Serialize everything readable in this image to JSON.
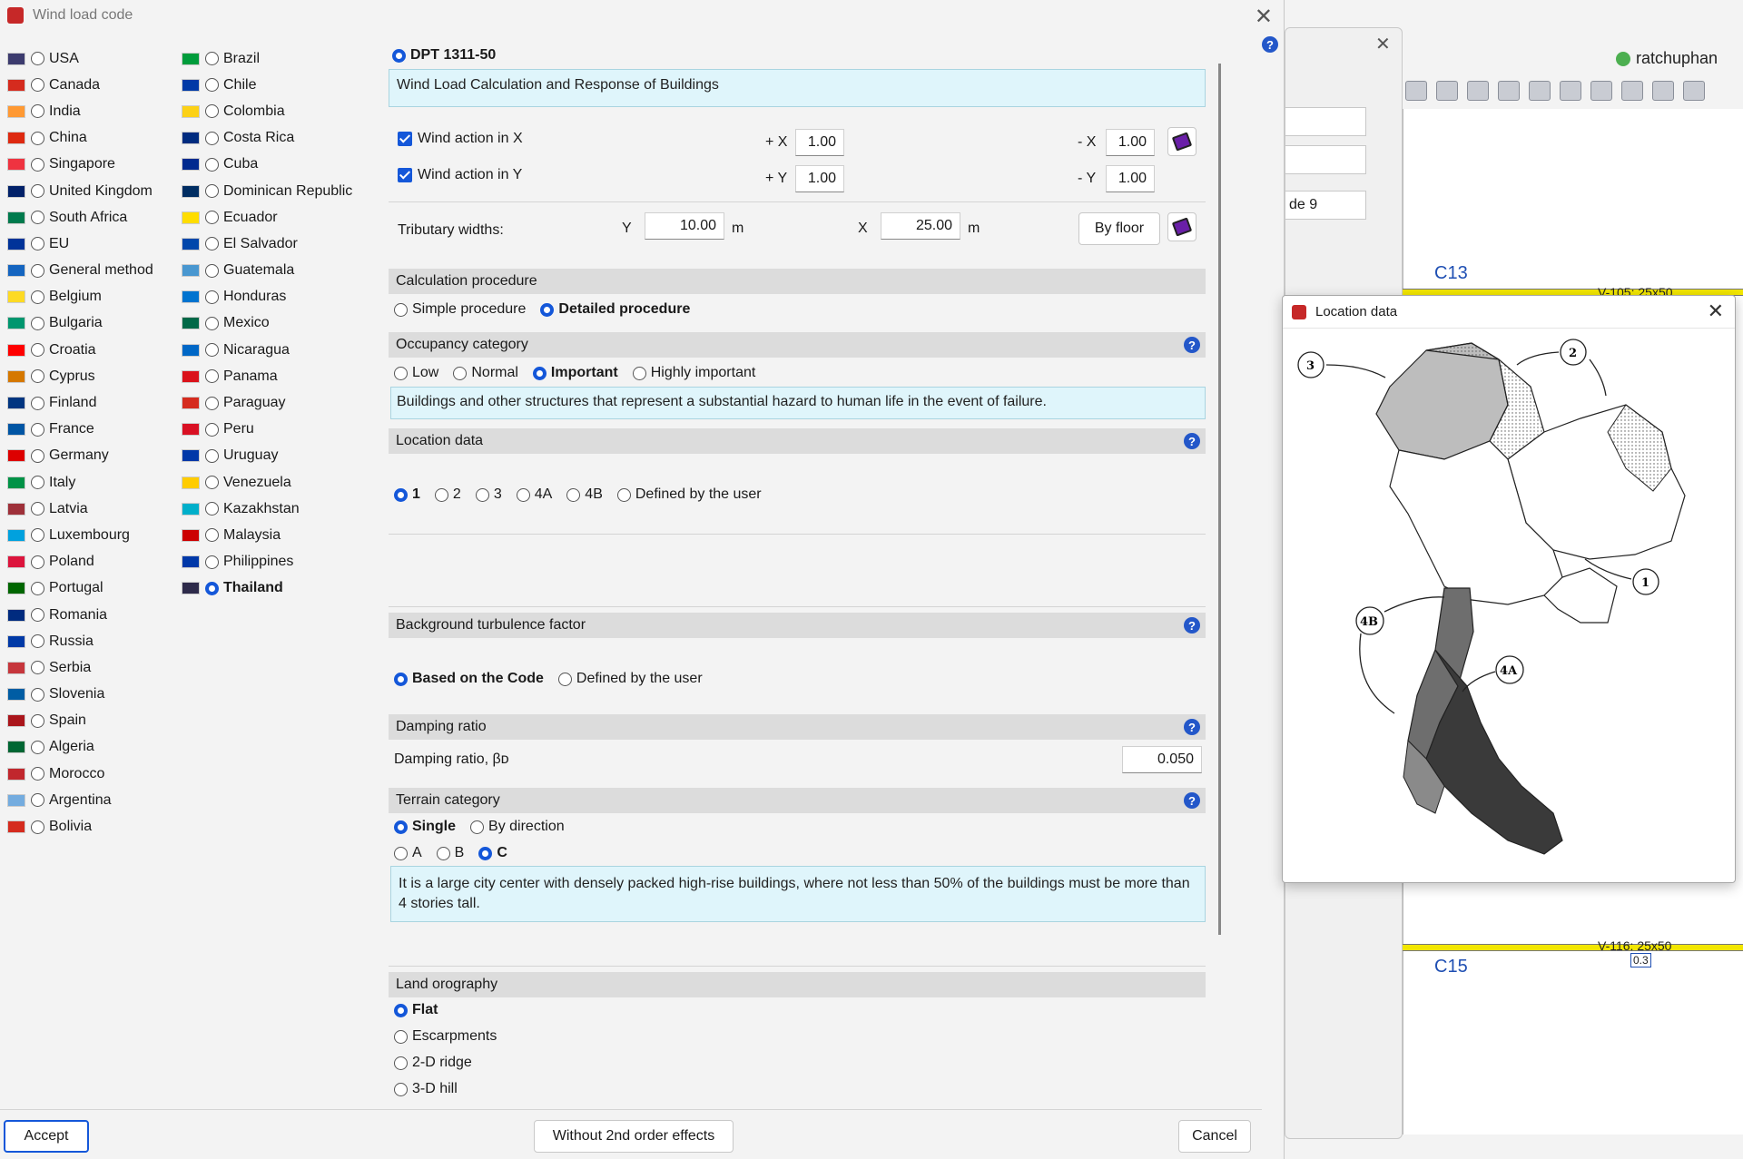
{
  "dialog": {
    "title": "Wind load code",
    "accept": "Accept",
    "second_order": "Without 2nd order effects",
    "cancel": "Cancel"
  },
  "countries_col1": [
    {
      "name": "USA",
      "selected": false,
      "flag_color": "#3c3b6e"
    },
    {
      "name": "Canada",
      "selected": false,
      "flag_color": "#d52b1e"
    },
    {
      "name": "India",
      "selected": false,
      "flag_color": "#ff9933"
    },
    {
      "name": "China",
      "selected": false,
      "flag_color": "#de2910"
    },
    {
      "name": "Singapore",
      "selected": false,
      "flag_color": "#ef3340"
    },
    {
      "name": "United Kingdom",
      "selected": false,
      "flag_color": "#012169"
    },
    {
      "name": "South Africa",
      "selected": false,
      "flag_color": "#007a4d"
    },
    {
      "name": "EU",
      "selected": false,
      "flag_color": "#003399"
    },
    {
      "name": "General method",
      "selected": false,
      "flag_color": "#1565c0"
    },
    {
      "name": "Belgium",
      "selected": false,
      "flag_color": "#fdda24"
    },
    {
      "name": "Bulgaria",
      "selected": false,
      "flag_color": "#00966e"
    },
    {
      "name": "Croatia",
      "selected": false,
      "flag_color": "#ff0000"
    },
    {
      "name": "Cyprus",
      "selected": false,
      "flag_color": "#d57800"
    },
    {
      "name": "Finland",
      "selected": false,
      "flag_color": "#003580"
    },
    {
      "name": "France",
      "selected": false,
      "flag_color": "#0055a4"
    },
    {
      "name": "Germany",
      "selected": false,
      "flag_color": "#dd0000"
    },
    {
      "name": "Italy",
      "selected": false,
      "flag_color": "#009246"
    },
    {
      "name": "Latvia",
      "selected": false,
      "flag_color": "#9e3039"
    },
    {
      "name": "Luxembourg",
      "selected": false,
      "flag_color": "#00a1de"
    },
    {
      "name": "Poland",
      "selected": false,
      "flag_color": "#dc143c"
    },
    {
      "name": "Portugal",
      "selected": false,
      "flag_color": "#006600"
    },
    {
      "name": "Romania",
      "selected": false,
      "flag_color": "#002b7f"
    },
    {
      "name": "Russia",
      "selected": false,
      "flag_color": "#0039a6"
    },
    {
      "name": "Serbia",
      "selected": false,
      "flag_color": "#c6363c"
    },
    {
      "name": "Slovenia",
      "selected": false,
      "flag_color": "#005da4"
    },
    {
      "name": "Spain",
      "selected": false,
      "flag_color": "#aa151b"
    },
    {
      "name": "Algeria",
      "selected": false,
      "flag_color": "#006633"
    },
    {
      "name": "Morocco",
      "selected": false,
      "flag_color": "#c1272d"
    },
    {
      "name": "Argentina",
      "selected": false,
      "flag_color": "#74acdf"
    },
    {
      "name": "Bolivia",
      "selected": false,
      "flag_color": "#d52b1e"
    }
  ],
  "countries_col2": [
    {
      "name": "Brazil",
      "selected": false,
      "flag_color": "#009c3b"
    },
    {
      "name": "Chile",
      "selected": false,
      "flag_color": "#0039a6"
    },
    {
      "name": "Colombia",
      "selected": false,
      "flag_color": "#fcd116"
    },
    {
      "name": "Costa Rica",
      "selected": false,
      "flag_color": "#002b7f"
    },
    {
      "name": "Cuba",
      "selected": false,
      "flag_color": "#002a8f"
    },
    {
      "name": "Dominican Republic",
      "selected": false,
      "flag_color": "#002d62"
    },
    {
      "name": "Ecuador",
      "selected": false,
      "flag_color": "#ffdd00"
    },
    {
      "name": "El Salvador",
      "selected": false,
      "flag_color": "#0047ab"
    },
    {
      "name": "Guatemala",
      "selected": false,
      "flag_color": "#4997d0"
    },
    {
      "name": "Honduras",
      "selected": false,
      "flag_color": "#0073cf"
    },
    {
      "name": "Mexico",
      "selected": false,
      "flag_color": "#006847"
    },
    {
      "name": "Nicaragua",
      "selected": false,
      "flag_color": "#0067c6"
    },
    {
      "name": "Panama",
      "selected": false,
      "flag_color": "#da121a"
    },
    {
      "name": "Paraguay",
      "selected": false,
      "flag_color": "#d52b1e"
    },
    {
      "name": "Peru",
      "selected": false,
      "flag_color": "#d91023"
    },
    {
      "name": "Uruguay",
      "selected": false,
      "flag_color": "#0038a8"
    },
    {
      "name": "Venezuela",
      "selected": false,
      "flag_color": "#ffcc00"
    },
    {
      "name": "Kazakhstan",
      "selected": false,
      "flag_color": "#00afca"
    },
    {
      "name": "Malaysia",
      "selected": false,
      "flag_color": "#cc0001"
    },
    {
      "name": "Philippines",
      "selected": false,
      "flag_color": "#0038a8"
    },
    {
      "name": "Thailand",
      "selected": true,
      "flag_color": "#2d2a4a"
    }
  ],
  "code": {
    "name": "DPT 1311-50",
    "description": "Wind Load Calculation and Response of Buildings"
  },
  "wind": {
    "x_label": "Wind action in X",
    "y_label": "Wind action in Y",
    "plus_x": "+ X",
    "plus_x_val": "1.00",
    "minus_x": "- X",
    "minus_x_val": "1.00",
    "plus_y": "+ Y",
    "plus_y_val": "1.00",
    "minus_y": "- Y",
    "minus_y_val": "1.00"
  },
  "tributary": {
    "label": "Tributary widths:",
    "y_label": "Y",
    "y_val": "10.00",
    "y_unit": "m",
    "x_label": "X",
    "x_val": "25.00",
    "x_unit": "m",
    "by_floor": "By floor"
  },
  "calc": {
    "head": "Calculation procedure",
    "simple": "Simple procedure",
    "detailed": "Detailed procedure"
  },
  "occupancy": {
    "head": "Occupancy category",
    "low": "Low",
    "normal": "Normal",
    "important": "Important",
    "highly": "Highly important",
    "desc": "Buildings and other structures that represent a substantial hazard to human life in the event of failure."
  },
  "location": {
    "head": "Location data",
    "z1": "1",
    "z2": "2",
    "z3": "3",
    "z4a": "4A",
    "z4b": "4B",
    "user": "Defined by the user"
  },
  "turbulence": {
    "head": "Background turbulence factor",
    "code": "Based on the Code",
    "user": "Defined by the user"
  },
  "damping": {
    "head": "Damping ratio",
    "label": "Damping ratio, βᴅ",
    "value": "0.050"
  },
  "terrain": {
    "head": "Terrain category",
    "single": "Single",
    "by_direction": "By direction",
    "a": "A",
    "b": "B",
    "c": "C",
    "desc": "It is a large city center with densely packed high-rise buildings, where not less than 50% of the buildings must be more than 4 stories tall."
  },
  "orography": {
    "head": "Land orography",
    "flat": "Flat",
    "escarpments": "Escarpments",
    "ridge": "2-D ridge",
    "hill": "3-D hill"
  },
  "popup": {
    "title": "Location data",
    "zones": [
      "3",
      "2",
      "1",
      "4B",
      "4A"
    ]
  },
  "background": {
    "user": "ratchuphan",
    "field_text": "de 9",
    "c13": "C13",
    "c15": "C15",
    "beam_top": "V-105: 25x50",
    "beam_bottom": "V-116: 25x50",
    "beam_tag": "0.3"
  }
}
